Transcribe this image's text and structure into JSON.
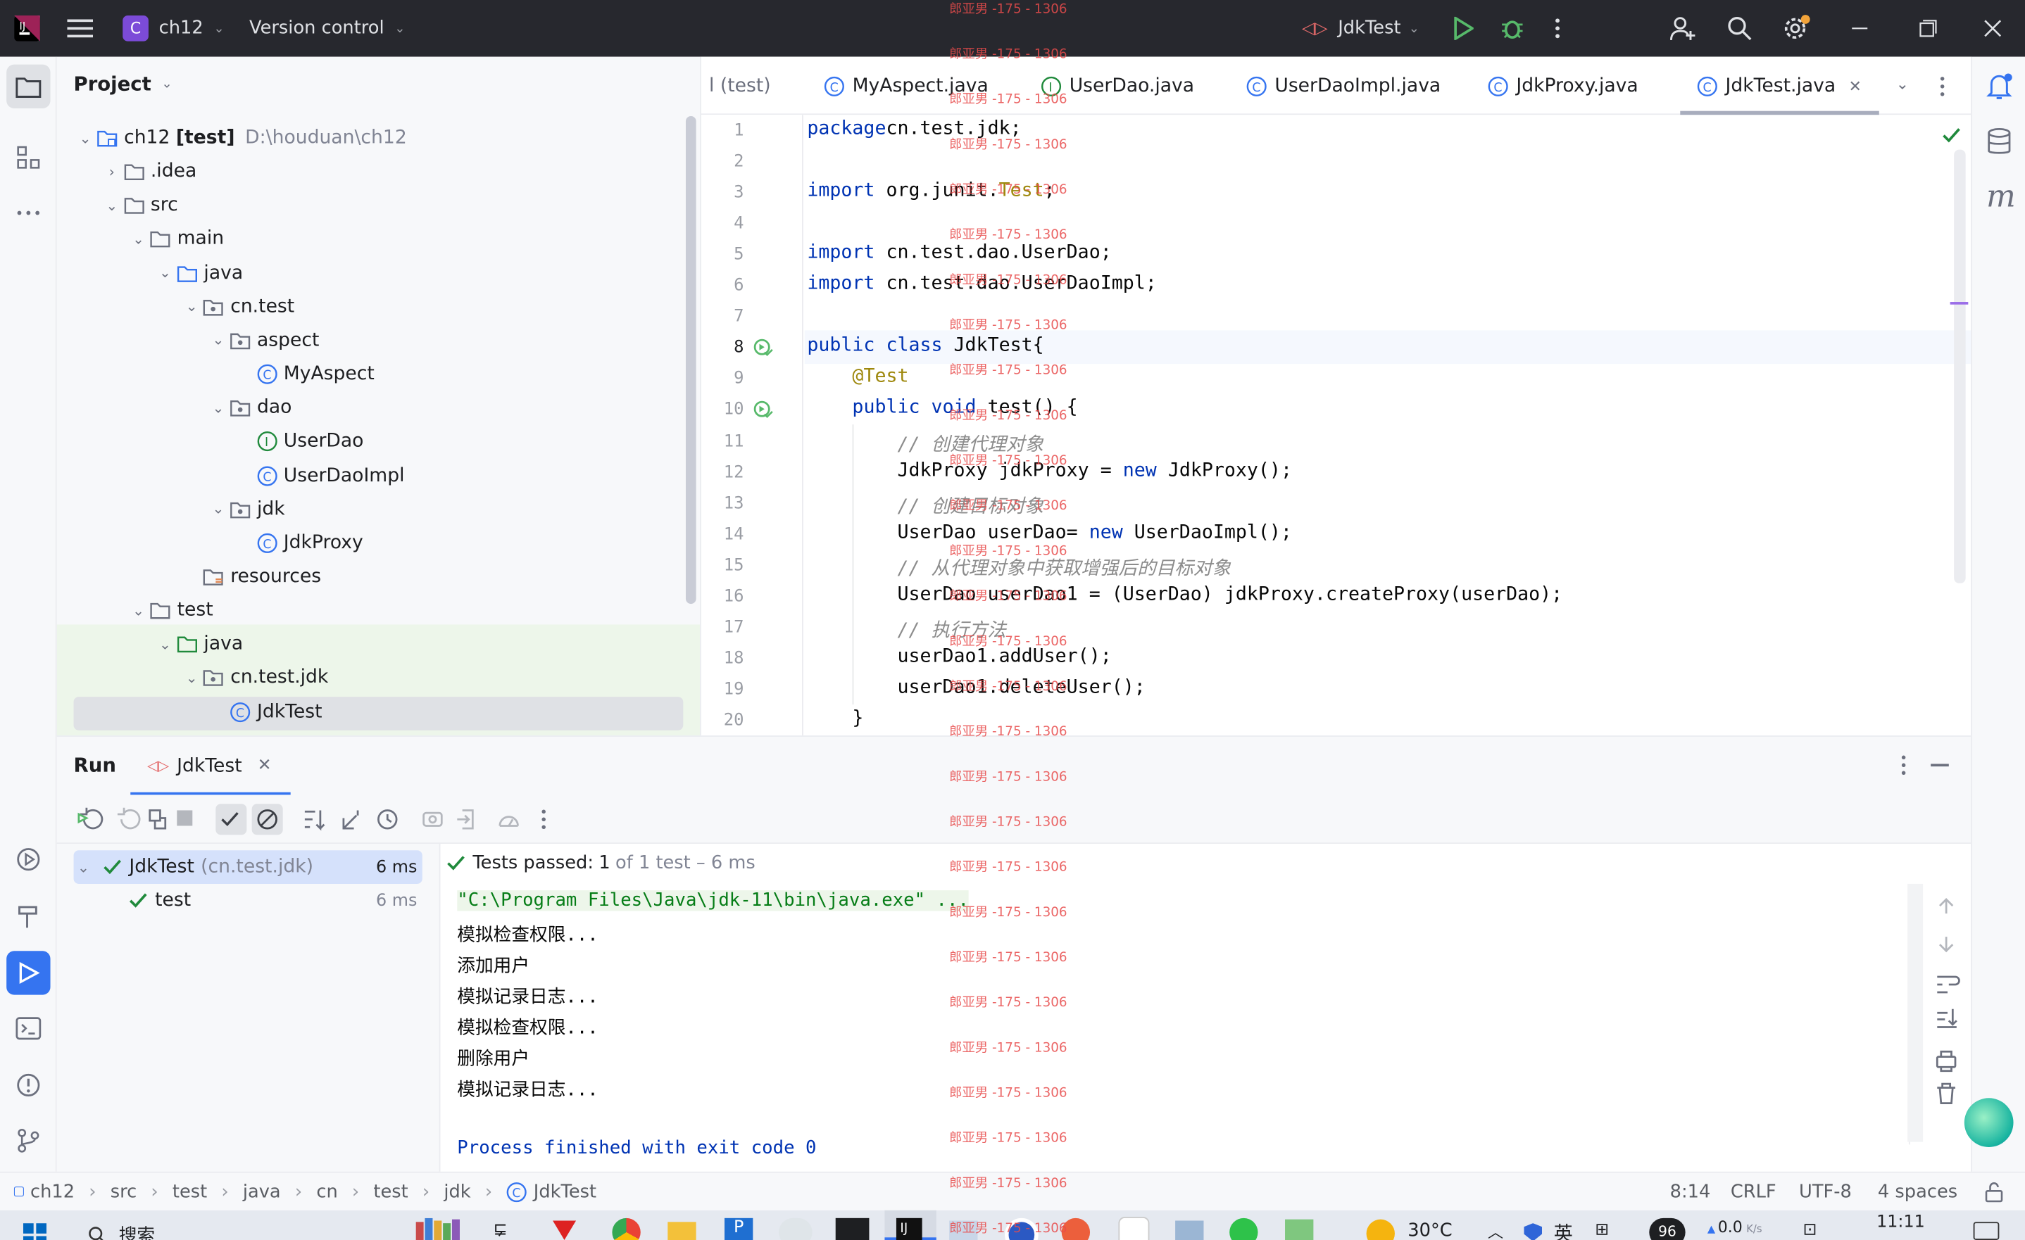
{
  "titlebar": {
    "project_badge": "C",
    "project_name": "ch12",
    "vcs_label": "Version control",
    "run_config": "JdkTest"
  },
  "project_panel": {
    "title": "Project",
    "tree": [
      {
        "label": "ch12 [test]",
        "hint": "D:\\houduan\\ch12",
        "kind": "module"
      },
      {
        "label": ".idea",
        "kind": "folder"
      },
      {
        "label": "src",
        "kind": "folder"
      },
      {
        "label": "main",
        "kind": "folder"
      },
      {
        "label": "java",
        "kind": "src-folder"
      },
      {
        "label": "cn.test",
        "kind": "package"
      },
      {
        "label": "aspect",
        "kind": "package"
      },
      {
        "label": "MyAspect",
        "kind": "class"
      },
      {
        "label": "dao",
        "kind": "package"
      },
      {
        "label": "UserDao",
        "kind": "interface"
      },
      {
        "label": "UserDaoImpl",
        "kind": "class"
      },
      {
        "label": "jdk",
        "kind": "package"
      },
      {
        "label": "JdkProxy",
        "kind": "class"
      },
      {
        "label": "resources",
        "kind": "res-folder"
      },
      {
        "label": "test",
        "kind": "folder"
      },
      {
        "label": "java",
        "kind": "test-folder"
      },
      {
        "label": "cn.test.jdk",
        "kind": "package"
      },
      {
        "label": "JdkTest",
        "kind": "class"
      }
    ]
  },
  "editor": {
    "tabs": [
      {
        "label": "l (test)"
      },
      {
        "label": "MyAspect.java"
      },
      {
        "label": "UserDao.java"
      },
      {
        "label": "UserDaoImpl.java"
      },
      {
        "label": "JdkProxy.java"
      },
      {
        "label": "JdkTest.java"
      }
    ],
    "line_numbers": [
      "1",
      "2",
      "3",
      "4",
      "5",
      "6",
      "7",
      "8",
      "9",
      "10",
      "11",
      "12",
      "13",
      "14",
      "15",
      "16",
      "17",
      "18",
      "19",
      "20"
    ],
    "lines": [
      {
        "indent": "",
        "parts": [
          [
            "kw",
            "package"
          ],
          [
            "",
            "cn.test.jdk;"
          ]
        ]
      },
      {
        "indent": "",
        "parts": []
      },
      {
        "indent": "",
        "parts": [
          [
            "kw",
            "import"
          ],
          [
            "",
            " org.junit."
          ],
          [
            "an",
            "Test"
          ],
          [
            "",
            ";"
          ]
        ]
      },
      {
        "indent": "",
        "parts": []
      },
      {
        "indent": "",
        "parts": [
          [
            "kw",
            "import"
          ],
          [
            "",
            " cn.test.dao.UserDao;"
          ]
        ]
      },
      {
        "indent": "",
        "parts": [
          [
            "kw",
            "import"
          ],
          [
            "",
            " cn.test.dao.UserDaoImpl;"
          ]
        ]
      },
      {
        "indent": "",
        "parts": []
      },
      {
        "indent": "",
        "parts": [
          [
            "kw",
            "public class"
          ],
          [
            "",
            " JdkTest{"
          ]
        ]
      },
      {
        "indent": "    ",
        "parts": [
          [
            "an",
            "@Test"
          ]
        ]
      },
      {
        "indent": "    ",
        "parts": [
          [
            "kw",
            "public void"
          ],
          [
            "",
            " test() {"
          ]
        ]
      },
      {
        "indent": "        ",
        "parts": [
          [
            "cm",
            "// 创建代理对象"
          ]
        ]
      },
      {
        "indent": "        ",
        "parts": [
          [
            "",
            "JdkProxy jdkProxy = "
          ],
          [
            "kw",
            "new"
          ],
          [
            "",
            " JdkProxy();"
          ]
        ]
      },
      {
        "indent": "        ",
        "parts": [
          [
            "cm",
            "// 创建目标对象"
          ]
        ]
      },
      {
        "indent": "        ",
        "parts": [
          [
            "",
            "UserDao userDao= "
          ],
          [
            "kw",
            "new"
          ],
          [
            "",
            " UserDaoImpl();"
          ]
        ]
      },
      {
        "indent": "        ",
        "parts": [
          [
            "cm",
            "// 从代理对象中获取增强后的目标对象"
          ]
        ]
      },
      {
        "indent": "        ",
        "parts": [
          [
            "",
            "UserDao userDao1 = (UserDao) jdkProxy.createProxy(userDao);"
          ]
        ]
      },
      {
        "indent": "        ",
        "parts": [
          [
            "cm",
            "// 执行方法"
          ]
        ]
      },
      {
        "indent": "        ",
        "parts": [
          [
            "",
            "userDao1.addUser();"
          ]
        ]
      },
      {
        "indent": "        ",
        "parts": [
          [
            "",
            "userDao1.deleteUser();"
          ]
        ]
      },
      {
        "indent": "    ",
        "parts": [
          [
            "",
            "}"
          ]
        ]
      }
    ]
  },
  "run_panel": {
    "title": "Run",
    "tab": "JdkTest",
    "tree": [
      {
        "label": "JdkTest",
        "hint": "(cn.test.jdk)",
        "time": "6 ms"
      },
      {
        "label": "test",
        "hint": "",
        "time": "6 ms"
      }
    ],
    "result_prefix": "Tests passed:",
    "result_count": "1",
    "result_suffix": "of 1 test – 6 ms",
    "console": [
      "\"C:\\Program Files\\Java\\jdk-11\\bin\\java.exe\" ...",
      "模拟检查权限...",
      "添加用户",
      "模拟记录日志...",
      "模拟检查权限...",
      "删除用户",
      "模拟记录日志...",
      "",
      "Process finished with exit code 0"
    ]
  },
  "statusbar": {
    "breadcrumb": [
      "ch12",
      "src",
      "test",
      "java",
      "cn",
      "test",
      "jdk",
      "JdkTest"
    ],
    "position": "8:14",
    "line_sep": "CRLF",
    "encoding": "UTF-8",
    "indent": "4 spaces"
  },
  "taskbar": {
    "search": "搜索",
    "weather": "30°C",
    "ime": "英",
    "net_speed": "0.0",
    "net_unit": "K/s",
    "time": "11:11",
    "badge": "96"
  },
  "watermark": "郎亚男 -175 - 1306",
  "colors": {
    "accent": "#3574f0",
    "titlebar_bg": "#27282e",
    "success": "#208a3c",
    "keyword": "#0033b3",
    "annotation": "#9e880d",
    "comment": "#8c8c8c",
    "watermark": "#e84c4c"
  }
}
